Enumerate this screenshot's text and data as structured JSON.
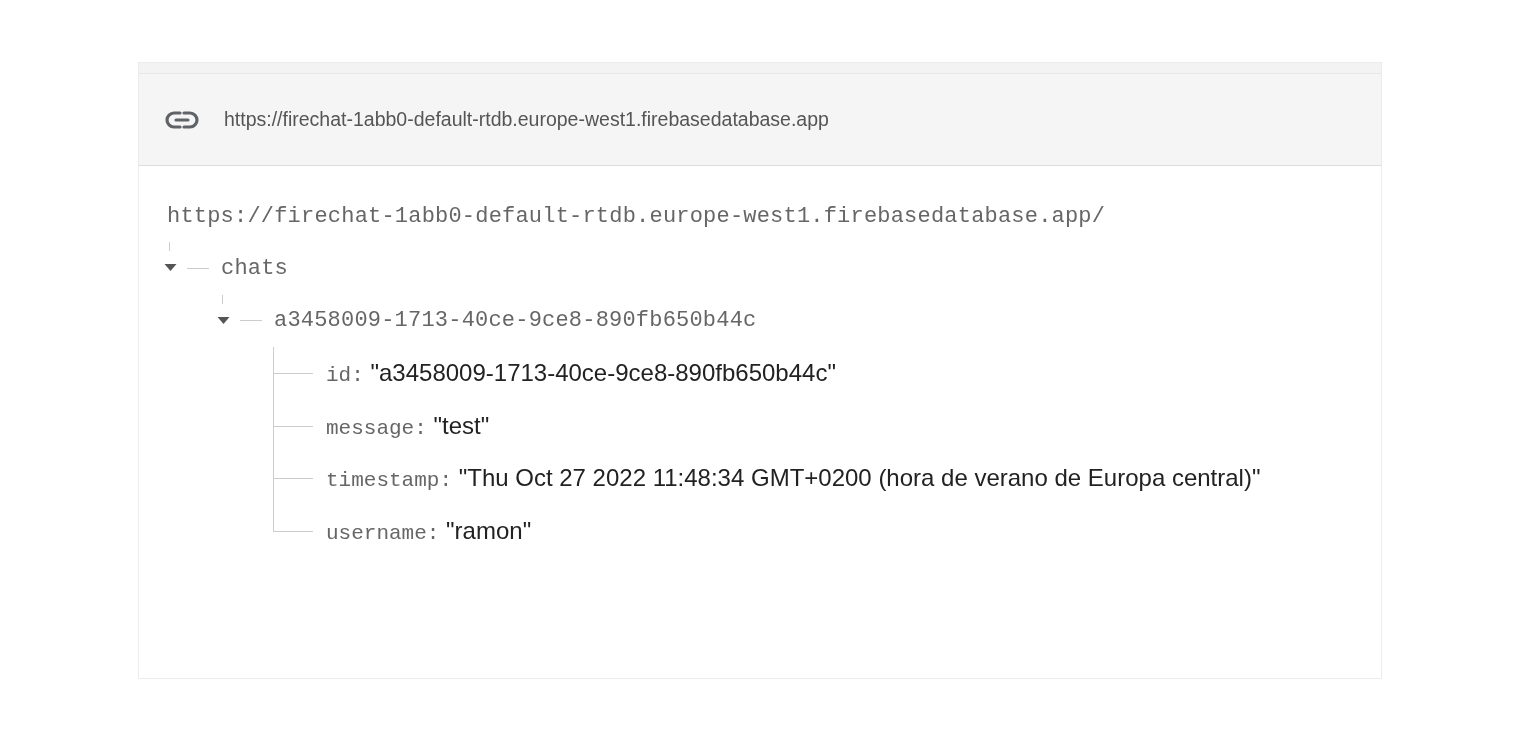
{
  "header": {
    "url": "https://firechat-1abb0-default-rtdb.europe-west1.firebasedatabase.app"
  },
  "tree": {
    "root": "https://firechat-1abb0-default-rtdb.europe-west1.firebasedatabase.app/",
    "children": [
      {
        "key": "chats",
        "expanded": true,
        "children": [
          {
            "key": "a3458009-1713-40ce-9ce8-890fb650b44c",
            "expanded": true,
            "children": [
              {
                "key": "id:",
                "value": "\"a3458009-1713-40ce-9ce8-890fb650b44c\""
              },
              {
                "key": "message:",
                "value": "\"test\""
              },
              {
                "key": "timestamp:",
                "value": "\"Thu Oct 27 2022 11:48:34 GMT+0200 (hora de verano de Europa central)\""
              },
              {
                "key": "username:",
                "value": "\"ramon\""
              }
            ]
          }
        ]
      }
    ]
  }
}
